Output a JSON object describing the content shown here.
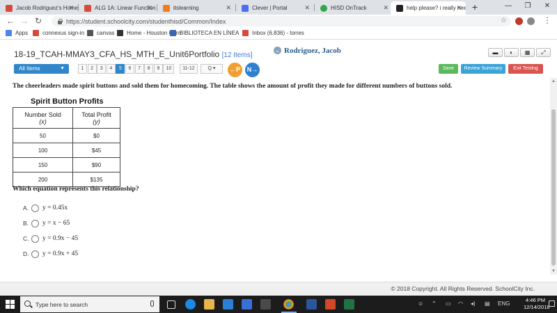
{
  "browser": {
    "tabs": [
      {
        "title": "Jacob Rodriguez's Home",
        "favicon_color": "#d64b3c",
        "active": false
      },
      {
        "title": "ALG 1A: Linear Function",
        "favicon_color": "#d64b3c",
        "active": false
      },
      {
        "title": "itslearning",
        "favicon_color": "#f07c20",
        "active": false
      },
      {
        "title": "Clever | Portal",
        "favicon_color": "#4c6ef5",
        "active": false
      },
      {
        "title": "HISD OnTrack",
        "favicon_color": "#2ea84a",
        "active": false
      },
      {
        "title": "help please? i really nee",
        "favicon_color": "#222222",
        "active": true
      }
    ],
    "new_tab_label": "+",
    "url": "https://student.schoolcity.com/studenthisd/Common/Index",
    "bookmarks": [
      {
        "label": "Apps",
        "icon_color": "#4a86e8"
      },
      {
        "label": "connexus sign-in",
        "icon_color": "#d64b3c"
      },
      {
        "label": "canvas",
        "icon_color": "#555555"
      },
      {
        "label": "Home - Houston Com",
        "icon_color": "#333333"
      },
      {
        "label": "BIBLIOTECA EN LÍNEA",
        "icon_color": "#3a66b0"
      },
      {
        "label": "Inbox (6,836) - torres",
        "icon_color": "#d64b3c"
      }
    ]
  },
  "header": {
    "title": "18-19_TCAH-MMAY3_CFA_HS_MTH_E_Unit6Portfolio",
    "items_count": "[12 Items]",
    "user_name": "Rodriguez, Jacob"
  },
  "toolbar": {
    "all_items_label": "All Items",
    "question_numbers": [
      "1",
      "2",
      "3",
      "4",
      "5",
      "6",
      "7",
      "8",
      "9",
      "10"
    ],
    "current_question": "5",
    "range_label": "11-12",
    "search_label": "Q ▾",
    "prev_label": "←P",
    "next_label": "N→",
    "save_label": "Save",
    "review_label": "Review Summary",
    "exit_label": "Exit Testing",
    "colors": {
      "primary": "#2f86c9",
      "save": "#5cb85c",
      "review": "#3aa3d8",
      "exit": "#d9534f",
      "prev": "#f0a030",
      "next": "#2f7fd0"
    }
  },
  "question": {
    "stem": "The cheerleaders made spirit buttons and sold them for homecoming. The table shows the amount of profit they made for different numbers of buttons sold.",
    "table_title": "Spirit Button Profits",
    "columns": [
      {
        "name": "Number Sold",
        "var": "(x)"
      },
      {
        "name": "Total Profit",
        "var": "(y)"
      }
    ],
    "rows": [
      [
        "50",
        "$0"
      ],
      [
        "100",
        "$45"
      ],
      [
        "150",
        "$90"
      ],
      [
        "200",
        "$135"
      ]
    ],
    "prompt": "Which equation represents this relationship?",
    "choices": [
      {
        "letter": "A.",
        "equation": "y = 0.45x"
      },
      {
        "letter": "B.",
        "equation": "y = x − 65"
      },
      {
        "letter": "C.",
        "equation": "y = 0.9x − 45"
      },
      {
        "letter": "D.",
        "equation": "y = 0.9x + 45"
      }
    ]
  },
  "footer": {
    "copyright": "© 2018 Copyright. All Rights Reserved. SchoolCity Inc."
  },
  "taskbar": {
    "search_placeholder": "Type here to search",
    "language": "ENG",
    "time": "4:46 PM",
    "date": "12/14/2018"
  }
}
